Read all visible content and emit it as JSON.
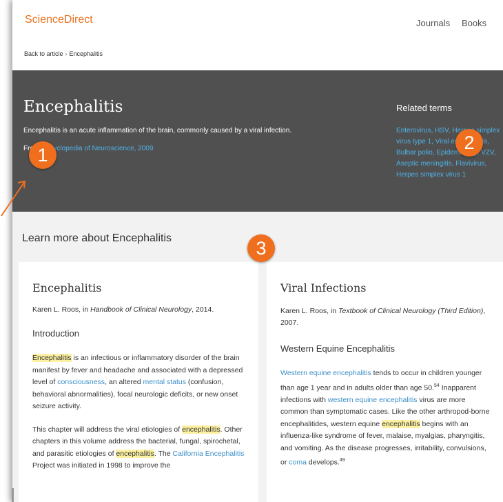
{
  "header": {
    "logo": "ScienceDirect",
    "nav": [
      "Journals",
      "Books"
    ]
  },
  "breadcrumb": {
    "back": "Back to article",
    "separator": "›",
    "current": "Encephalitis"
  },
  "hero": {
    "title": "Encephalitis",
    "description": "Encephalitis is an acute inflammation of the brain, commonly caused by a viral infection.",
    "source_prefix": "From",
    "source_link": "Encyclopedia of Neuroscience, 2009",
    "related_title": "Related terms",
    "related_terms_visible": "Enterovirus, HSV, Herpes simplex virus type 1, Viral encephalitis, Bulbar polio, Epidemiology, VZV, Aseptic meningitis, Flavivirus, Herpes simplex virus 1"
  },
  "learn_more": {
    "title": "Learn more about Encephalitis"
  },
  "cards": [
    {
      "title": "Encephalitis",
      "author": "Karen L. Roos, in",
      "book": "Handbook of Clinical Neurology",
      "year": ", 2014.",
      "section": "Introduction",
      "p1": {
        "h1": "Encephalitis",
        "t1": " is an infectious or inflammatory disorder of the brain manifest by fever and headache and associated with a depressed level of ",
        "l1": "consciousness",
        "t2": ", an altered ",
        "l2": "mental status",
        "t3": " (confusion, behavioral abnormalities), focal neurologic deficits, or new onset seizure activity."
      },
      "p2": {
        "t1": "This chapter will address the viral etiologies of ",
        "h1": "encephalitis",
        "t2": ". Other chapters in this volume address the bacterial, fungal, spirochetal, and parasitic etiologies of ",
        "h2": "encephalitis",
        "t3": ". The ",
        "l1": "California Encephalitis",
        "t4": " Project was initiated in 1998 to improve the"
      }
    },
    {
      "title": "Viral Infections",
      "author": "Karen L. Roos, in",
      "book": "Textbook of Clinical Neurology (Third Edition)",
      "year": ", 2007.",
      "section": "Western Equine Encephalitis",
      "p1": {
        "l1": "Western equine encephalitis",
        "t1": " tends to occur in children younger than age 1 year and in adults older than age 50.",
        "s1": "54",
        "t2": " Inapparent infections with ",
        "l2": "western equine encephalitis",
        "t3": " virus are more common than symptomatic cases. Like the other arthropod-borne encephalitides, western equine ",
        "h1": "encephalitis",
        "t4": " begins with an influenza-like syndrome of fever, malaise, myalgias, pharyngitis, and vomiting. As the disease progresses, irritability, convulsions, or ",
        "l3": "coma",
        "t5": " develops.",
        "s2": "49"
      }
    }
  ],
  "annotations": [
    "1",
    "2",
    "3"
  ],
  "colors": {
    "brand": "#e9711c",
    "hero_bg": "#505050",
    "link": "#3b8fc7",
    "highlight": "#fcf1a2",
    "badge": "#ef6f1f"
  }
}
